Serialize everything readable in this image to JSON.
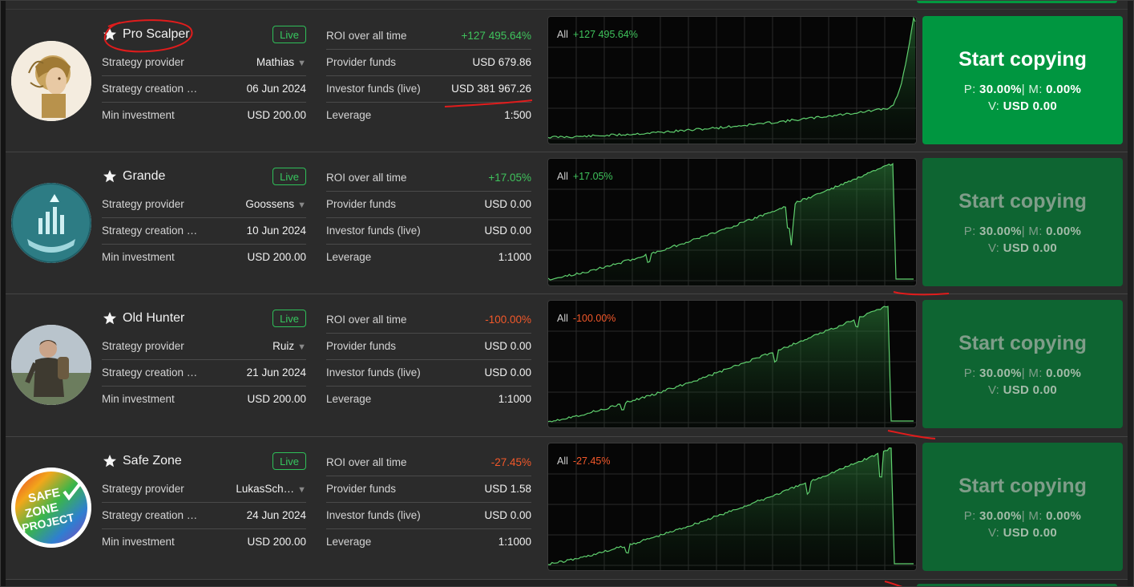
{
  "labels": {
    "provider": "Strategy provider",
    "creation": "Strategy creation …",
    "min_investment": "Min investment",
    "roi": "ROI over all time",
    "provider_funds": "Provider funds",
    "investor_funds": "Investor funds (live)",
    "leverage": "Leverage",
    "chart_period": "All",
    "copy_button": "Start copying",
    "fee_p": "P:",
    "fee_m": "M:",
    "fee_v": "V:",
    "fee_sep": "|"
  },
  "colors": {
    "positive": "#3fc35c",
    "negative": "#f2582a",
    "button_active": "#009640",
    "button_inactive": "#0e6532",
    "live_badge": "#2fbf59",
    "annotation": "#e01c1c"
  },
  "strategies": [
    {
      "name": "Pro Scalper",
      "status": "Live",
      "provider": "Mathias",
      "created": "06 Jun 2024",
      "min_investment": "USD 200.00",
      "roi": "+127 495.64%",
      "roi_sign": "positive",
      "provider_funds": "USD 679.86",
      "investor_funds": "USD 381 967.26",
      "leverage": "1:500",
      "fee_p": "30.00%",
      "fee_m": "0.00%",
      "fee_v": "USD 0.00",
      "button_state": "active",
      "avatar": "robot-avatar-icon"
    },
    {
      "name": "Grande",
      "status": "Live",
      "provider": "Goossens",
      "created": "10 Jun 2024",
      "min_investment": "USD 200.00",
      "roi": "+17.05%",
      "roi_sign": "positive",
      "provider_funds": "USD 0.00",
      "investor_funds": "USD 0.00",
      "leverage": "1:1000",
      "fee_p": "30.00%",
      "fee_m": "0.00%",
      "fee_v": "USD 0.00",
      "button_state": "inactive",
      "avatar": "growth-hands-avatar-icon"
    },
    {
      "name": "Old Hunter",
      "status": "Live",
      "provider": "Ruiz",
      "created": "21 Jun 2024",
      "min_investment": "USD 200.00",
      "roi": "-100.00%",
      "roi_sign": "negative",
      "provider_funds": "USD 0.00",
      "investor_funds": "USD 0.00",
      "leverage": "1:1000",
      "fee_p": "30.00%",
      "fee_m": "0.00%",
      "fee_v": "USD 0.00",
      "button_state": "inactive",
      "avatar": "hunter-avatar-icon"
    },
    {
      "name": "Safe Zone",
      "status": "Live",
      "provider": "LukasSch…",
      "created": "24 Jun 2024",
      "min_investment": "USD 200.00",
      "roi": "-27.45%",
      "roi_sign": "negative",
      "provider_funds": "USD 1.58",
      "investor_funds": "USD 0.00",
      "leverage": "1:1000",
      "fee_p": "30.00%",
      "fee_m": "0.00%",
      "fee_v": "USD 0.00",
      "button_state": "inactive",
      "avatar": "safe-zone-logo-icon",
      "logo_lines": [
        "SAFE",
        "ZONE",
        "PROJECT"
      ]
    }
  ]
}
